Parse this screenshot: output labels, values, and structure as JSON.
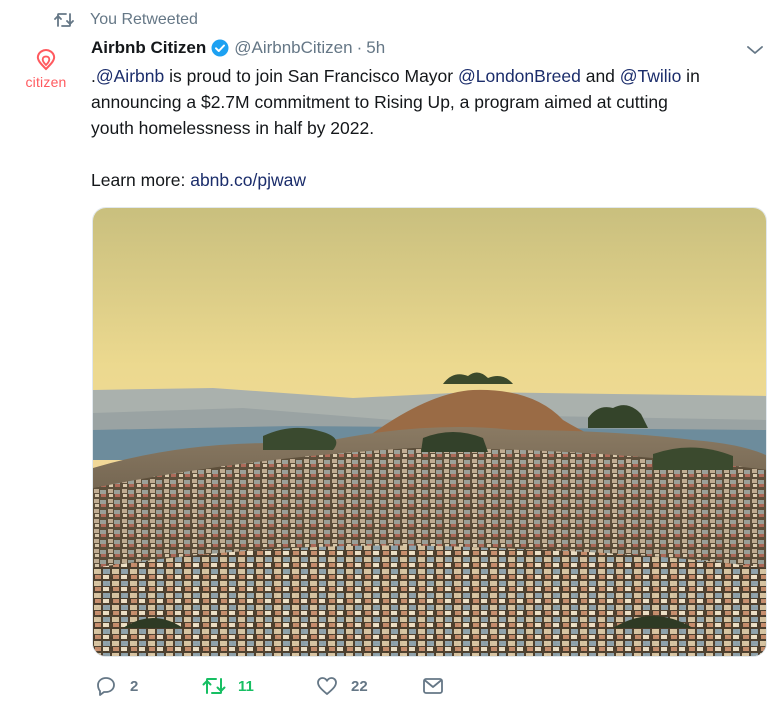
{
  "retweet_context": {
    "icon": "retweet-icon",
    "text": "You Retweeted"
  },
  "author": {
    "avatar_text": "citizen",
    "name": "Airbnb Citizen",
    "verified_icon": "verified-badge-icon",
    "handle": "@AirbnbCitizen",
    "separator": "·",
    "time": "5h"
  },
  "tweet": {
    "line1_prefix": ".",
    "mention_airbnb": "@Airbnb",
    "line1_mid": " is proud to join San Francisco Mayor ",
    "mention_breed": "@LondonBreed",
    "line1_and": " and ",
    "mention_twilio": "@Twilio",
    "line1_suffix": " in",
    "line2": "announcing a $2.7M commitment to Rising Up, a program aimed at cutting",
    "line3": "youth homelessness in half by 2022.",
    "learn_more": "Learn more: ",
    "link": "abnb.co/pjwaw"
  },
  "actions": {
    "reply": {
      "icon": "reply-icon",
      "count": "2"
    },
    "retweet": {
      "icon": "retweet-icon",
      "count": "11",
      "active_color": "#17bf63"
    },
    "like": {
      "icon": "heart-icon",
      "count": "22"
    },
    "dm": {
      "icon": "envelope-icon"
    }
  },
  "colors": {
    "brand": "#ff5a5f",
    "link": "#1b2d6b",
    "muted": "#657786",
    "verified": "#1da1f2"
  }
}
